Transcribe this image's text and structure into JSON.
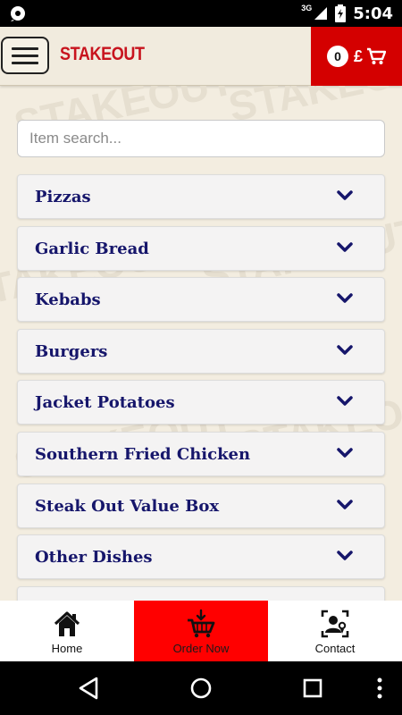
{
  "status_bar": {
    "time": "5:04",
    "network": "3G"
  },
  "header": {
    "brand": "STAKEOUT",
    "menu_icon": "hamburger-menu-icon",
    "cart": {
      "count": "0",
      "currency": "£",
      "icon": "shopping-cart-icon"
    }
  },
  "search": {
    "placeholder": "Item search...",
    "value": ""
  },
  "categories": [
    {
      "label": "Pizzas"
    },
    {
      "label": "Garlic Bread"
    },
    {
      "label": "Kebabs"
    },
    {
      "label": "Burgers"
    },
    {
      "label": "Jacket Potatoes"
    },
    {
      "label": "Southern Fried Chicken"
    },
    {
      "label": "Steak Out Value Box"
    },
    {
      "label": "Other Dishes"
    }
  ],
  "bottom_nav": {
    "items": [
      {
        "label": "Home",
        "icon": "home-icon"
      },
      {
        "label": "Order Now",
        "icon": "order-basket-icon",
        "active": true
      },
      {
        "label": "Contact",
        "icon": "contact-card-icon"
      }
    ]
  },
  "colors": {
    "brand_red": "#c8141e",
    "cart_red": "#d40000",
    "active_tab_red": "#ff0000",
    "category_text": "#16166b",
    "background": "#f3ede0"
  }
}
